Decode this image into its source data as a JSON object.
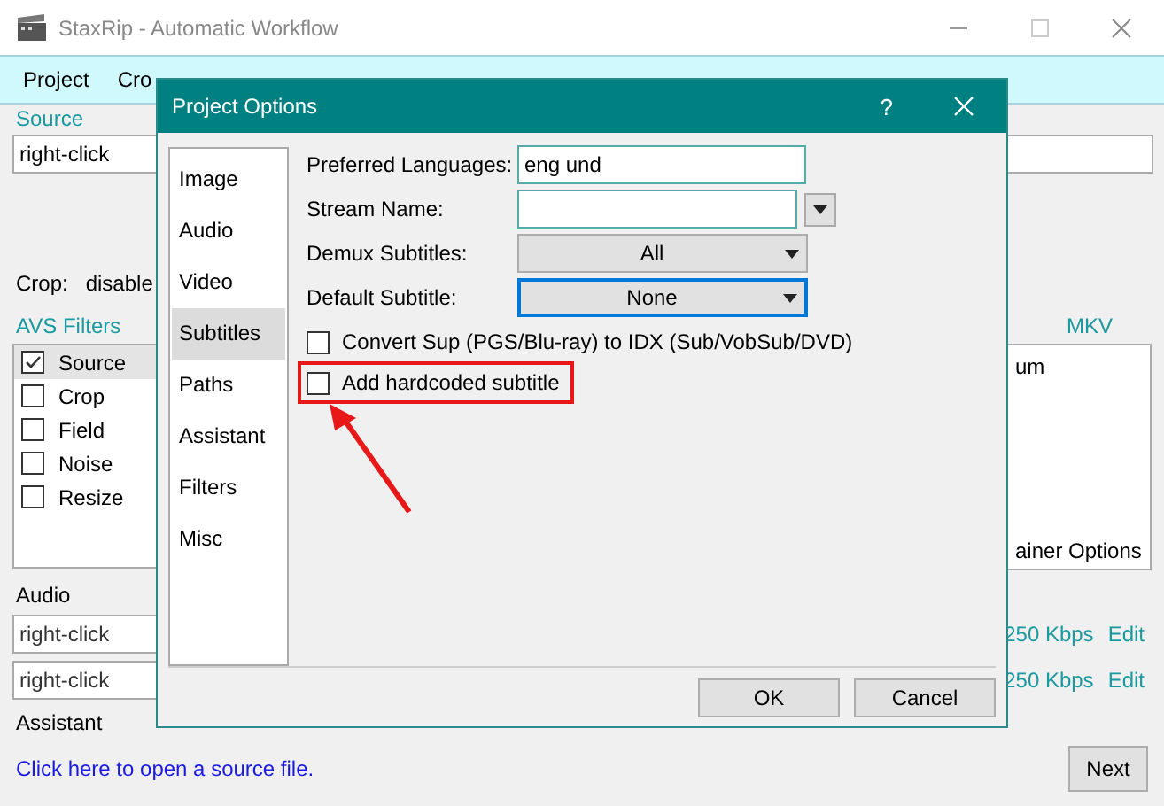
{
  "window": {
    "title": "StaxRip - Automatic Workflow"
  },
  "menu": [
    "Project",
    "Cro"
  ],
  "source": {
    "label": "Source",
    "value": "right-click",
    "crop_label": "Crop:",
    "crop_value": "disable"
  },
  "avs_filters": {
    "label": "AVS Filters",
    "rows": [
      {
        "name": "Source",
        "checked": true,
        "selected": true
      },
      {
        "name": "Crop",
        "checked": false,
        "selected": false
      },
      {
        "name": "Field",
        "checked": false,
        "selected": false
      },
      {
        "name": "Noise",
        "checked": false,
        "selected": false
      },
      {
        "name": "Resize",
        "checked": false,
        "selected": false
      }
    ]
  },
  "container": {
    "label": "MKV",
    "lines": [
      "um",
      "ainer Options"
    ]
  },
  "audio": {
    "label": "Audio",
    "tracks": [
      {
        "value": "right-click",
        "bitrate": "250 Kbps",
        "edit": "Edit"
      },
      {
        "value": "right-click",
        "bitrate": "250 Kbps",
        "edit": "Edit"
      }
    ]
  },
  "assistant": {
    "label": "Assistant",
    "link": "Click here to open a source file.",
    "next": "Next"
  },
  "dialog": {
    "title": "Project Options",
    "help": "?",
    "pages": [
      {
        "label": "Image",
        "selected": false
      },
      {
        "label": "Audio",
        "selected": false
      },
      {
        "label": "Video",
        "selected": false
      },
      {
        "label": "Subtitles",
        "selected": true
      },
      {
        "label": "Paths",
        "selected": false
      },
      {
        "label": "Assistant",
        "selected": false
      },
      {
        "label": "Filters",
        "selected": false
      },
      {
        "label": "Misc",
        "selected": false
      }
    ],
    "fields": [
      {
        "kind": "text",
        "label": "Preferred Languages:",
        "value": "eng und"
      },
      {
        "kind": "text_menu",
        "label": "Stream Name:"
      },
      {
        "kind": "combo",
        "label": "Demux Subtitles:",
        "value": "All",
        "focused": false
      },
      {
        "kind": "combo",
        "label": "Default Subtitle:",
        "value": "None",
        "focused": true
      }
    ],
    "checkboxes": [
      {
        "label": "Convert Sup (PGS/Blu-ray) to IDX (Sub/VobSub/DVD)",
        "checked": false,
        "highlighted": false
      },
      {
        "label": "Add hardcoded subtitle",
        "checked": false,
        "highlighted": true
      }
    ],
    "buttons": [
      "OK",
      "Cancel"
    ]
  }
}
